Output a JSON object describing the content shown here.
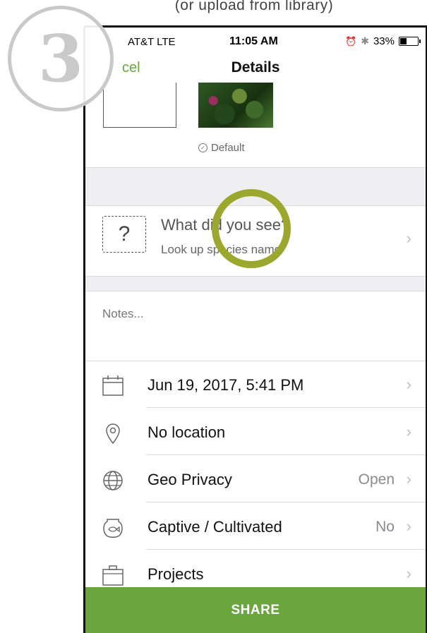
{
  "caption": "(or upload from library)",
  "step_number": "3",
  "status_bar": {
    "carrier": "AT&T  LTE",
    "time": "11:05 AM",
    "battery": "33%",
    "battery_level": 0.33
  },
  "navbar": {
    "back_label": "cel",
    "title": "Details"
  },
  "photos": {
    "default_label": "Default"
  },
  "species": {
    "title": "What did you see?",
    "subtitle": "Look up species name"
  },
  "notes_placeholder": "Notes...",
  "rows": [
    {
      "icon": "calendar-icon",
      "label": "Jun 19, 2017, 5:41 PM",
      "value": ""
    },
    {
      "icon": "location-pin-icon",
      "label": "No location",
      "value": ""
    },
    {
      "icon": "globe-icon",
      "label": "Geo Privacy",
      "value": "Open"
    },
    {
      "icon": "fishbowl-icon",
      "label": "Captive / Cultivated",
      "value": "No"
    },
    {
      "icon": "briefcase-icon",
      "label": "Projects",
      "value": ""
    }
  ],
  "share_label": "SHARE",
  "colors": {
    "accent_green": "#6aa53d",
    "highlight_ring": "#9ca72e"
  }
}
